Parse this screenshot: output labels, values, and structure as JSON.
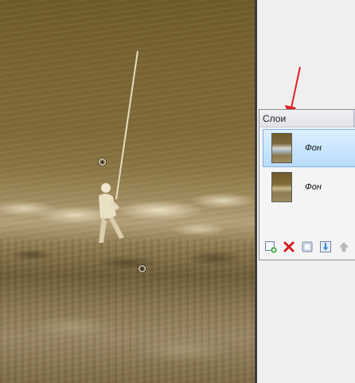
{
  "layers_panel": {
    "title": "Слои",
    "layers": [
      {
        "name": "Фон",
        "selected": true
      },
      {
        "name": "Фон",
        "selected": false
      }
    ],
    "toolbar": [
      {
        "icon": "add-layer-icon"
      },
      {
        "icon": "delete-layer-icon"
      },
      {
        "icon": "duplicate-layer-icon"
      },
      {
        "icon": "merge-down-icon"
      },
      {
        "icon": "move-up-icon"
      }
    ]
  },
  "colors": {
    "selection": "#b9dcfa",
    "annotation_arrow": "#e02020",
    "sepia_dark": "#6f5b2a"
  }
}
